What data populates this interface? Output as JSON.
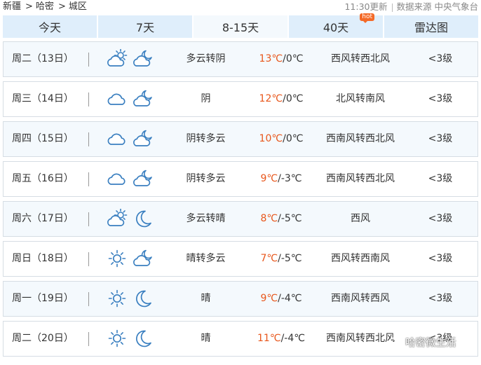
{
  "breadcrumb": [
    "新疆",
    "哈密",
    "城区"
  ],
  "breadcrumb_sep": ">",
  "update_time": "11:30更新",
  "source": "数据来源 中央气象台",
  "tabs": [
    {
      "label": "今天"
    },
    {
      "label": "7天"
    },
    {
      "label": "8-15天",
      "active": true
    },
    {
      "label": "40天",
      "badge": "hot"
    },
    {
      "label": "雷达图"
    }
  ],
  "forecast": [
    {
      "day": "周二（13日）",
      "icon_day": "partly-cloudy-day-icon",
      "icon_night": "partly-cloudy-night-icon",
      "desc": "多云转阴",
      "high": "13℃",
      "low": "0℃",
      "wind": "西风转西北风",
      "level": "<3级"
    },
    {
      "day": "周三（14日）",
      "icon_day": "cloudy-icon",
      "icon_night": "partly-cloudy-night-icon",
      "desc": "阴",
      "high": "12℃",
      "low": "0℃",
      "wind": "北风转南风",
      "level": "<3级"
    },
    {
      "day": "周四（15日）",
      "icon_day": "cloudy-icon",
      "icon_night": "partly-cloudy-night-icon",
      "desc": "阴转多云",
      "high": "10℃",
      "low": "0℃",
      "wind": "西南风转西北风",
      "level": "<3级"
    },
    {
      "day": "周五（16日）",
      "icon_day": "cloudy-icon",
      "icon_night": "partly-cloudy-night-icon",
      "desc": "阴转多云",
      "high": "9℃",
      "low": "-3℃",
      "wind": "西南风转西北风",
      "level": "<3级"
    },
    {
      "day": "周六（17日）",
      "icon_day": "partly-cloudy-day-icon",
      "icon_night": "moon-icon",
      "desc": "多云转晴",
      "high": "8℃",
      "low": "-5℃",
      "wind": "西风",
      "level": "<3级"
    },
    {
      "day": "周日（18日）",
      "icon_day": "sun-icon",
      "icon_night": "partly-cloudy-night-icon",
      "desc": "晴转多云",
      "high": "7℃",
      "low": "-5℃",
      "wind": "西风转西南风",
      "level": "<3级"
    },
    {
      "day": "周一（19日）",
      "icon_day": "sun-icon",
      "icon_night": "moon-icon",
      "desc": "晴",
      "high": "9℃",
      "low": "-4℃",
      "wind": "西南风转西风",
      "level": "<3级"
    },
    {
      "day": "周二（20日）",
      "icon_day": "sun-icon",
      "icon_night": "moon-icon",
      "desc": "晴",
      "high": "11℃",
      "low": "-4℃",
      "wind": "西南风转西北风",
      "level": "<3级"
    }
  ],
  "watermark": "哈密微生活",
  "colors": {
    "icon": "#3a7fc0",
    "high_temp": "#e8561b",
    "tab_bg": "#dfeefb",
    "row_shade": "#f4f9fd",
    "hot_badge": "#f46a28"
  }
}
